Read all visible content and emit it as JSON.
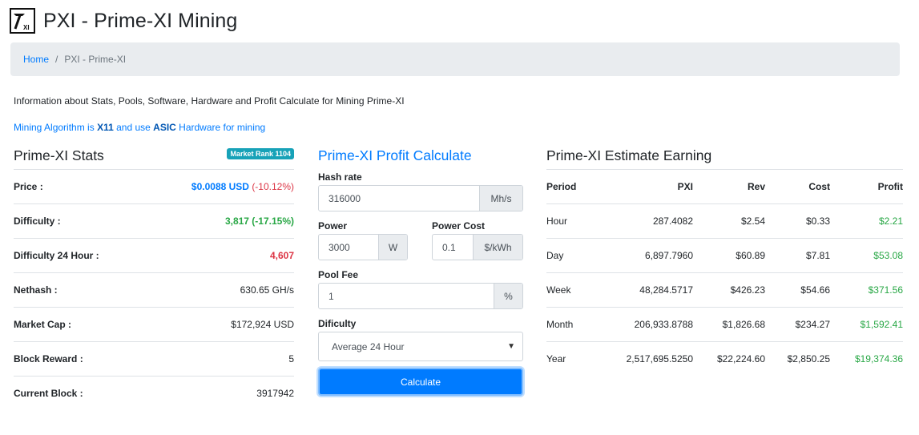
{
  "page": {
    "title": "PXI - Prime-XI Mining",
    "logo_text": "XI"
  },
  "breadcrumb": {
    "home": "Home",
    "separator": "/",
    "current": "PXI - Prime-XI"
  },
  "intro": "Information about Stats, Pools, Software, Hardware and Profit Calculate for Mining Prime-XI",
  "algorithm_line": {
    "prefix": "Mining Algorithm is",
    "algorithm": "X11",
    "middle": "and use",
    "hardware": "ASIC",
    "suffix": "Hardware for mining"
  },
  "stats": {
    "title": "Prime-XI Stats",
    "rank_badge": "Market Rank 1104",
    "rows": [
      {
        "label": "Price :",
        "value": "$0.0088 USD",
        "change": "(-10.12%)"
      },
      {
        "label": "Difficulty :",
        "value": "3,817 (-17.15%)"
      },
      {
        "label": "Difficulty 24 Hour :",
        "value": "4,607"
      },
      {
        "label": "Nethash :",
        "value": "630.65 GH/s"
      },
      {
        "label": "Market Cap :",
        "value": "$172,924 USD"
      },
      {
        "label": "Block Reward :",
        "value": "5"
      },
      {
        "label": "Current Block :",
        "value": "3917942"
      }
    ]
  },
  "calculator": {
    "title": "Prime-XI Profit Calculate",
    "hash_rate": {
      "label": "Hash rate",
      "value": "316000",
      "unit": "Mh/s"
    },
    "power": {
      "label": "Power",
      "value": "3000",
      "unit": "W"
    },
    "power_cost": {
      "label": "Power Cost",
      "value": "0.1",
      "unit": "$/kWh"
    },
    "pool_fee": {
      "label": "Pool Fee",
      "value": "1",
      "unit": "%"
    },
    "difficulty": {
      "label": "Dificulty",
      "selected": "Average 24 Hour"
    },
    "button": "Calculate"
  },
  "earnings": {
    "title": "Prime-XI Estimate Earning",
    "headers": [
      "Period",
      "PXI",
      "Rev",
      "Cost",
      "Profit"
    ],
    "rows": [
      [
        "Hour",
        "287.4082",
        "$2.54",
        "$0.33",
        "$2.21"
      ],
      [
        "Day",
        "6,897.7960",
        "$60.89",
        "$7.81",
        "$53.08"
      ],
      [
        "Week",
        "48,284.5717",
        "$426.23",
        "$54.66",
        "$371.56"
      ],
      [
        "Month",
        "206,933.8788",
        "$1,826.68",
        "$234.27",
        "$1,592.41"
      ],
      [
        "Year",
        "2,517,695.5250",
        "$22,224.60",
        "$2,850.25",
        "$19,374.36"
      ]
    ]
  },
  "colors": {
    "link": "#007bff",
    "positive": "#28a745",
    "negative": "#dc3545",
    "badge": "#17a2b8"
  }
}
